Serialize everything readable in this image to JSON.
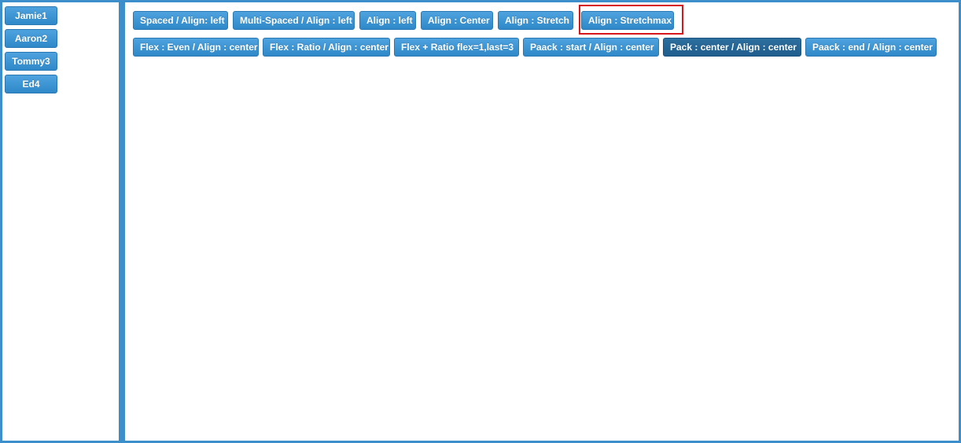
{
  "sidebar": {
    "items": [
      {
        "label": "Jamie1"
      },
      {
        "label": "Aaron2"
      },
      {
        "label": "Tommy3"
      },
      {
        "label": "Ed4"
      }
    ]
  },
  "toolbar": {
    "row1": [
      {
        "label": "Spaced / Align: left"
      },
      {
        "label": "Multi-Spaced / Align : left"
      },
      {
        "label": "Align : left"
      },
      {
        "label": "Align : Center"
      },
      {
        "label": "Align : Stretch"
      },
      {
        "label": "Align : Stretchmax"
      }
    ],
    "row2": [
      {
        "label": "Flex : Even / Align : center"
      },
      {
        "label": "Flex : Ratio / Align : center"
      },
      {
        "label": "Flex + Ratio flex=1,last=3"
      },
      {
        "label": "Paack : start / Align : center"
      },
      {
        "label": "Pack : center / Align : center"
      },
      {
        "label": "Paack : end / Align : center"
      }
    ]
  },
  "colors": {
    "accent": "#3d8fcc",
    "button": "#3a94d6",
    "button_active": "#25699a",
    "highlight": "#d8191c"
  }
}
